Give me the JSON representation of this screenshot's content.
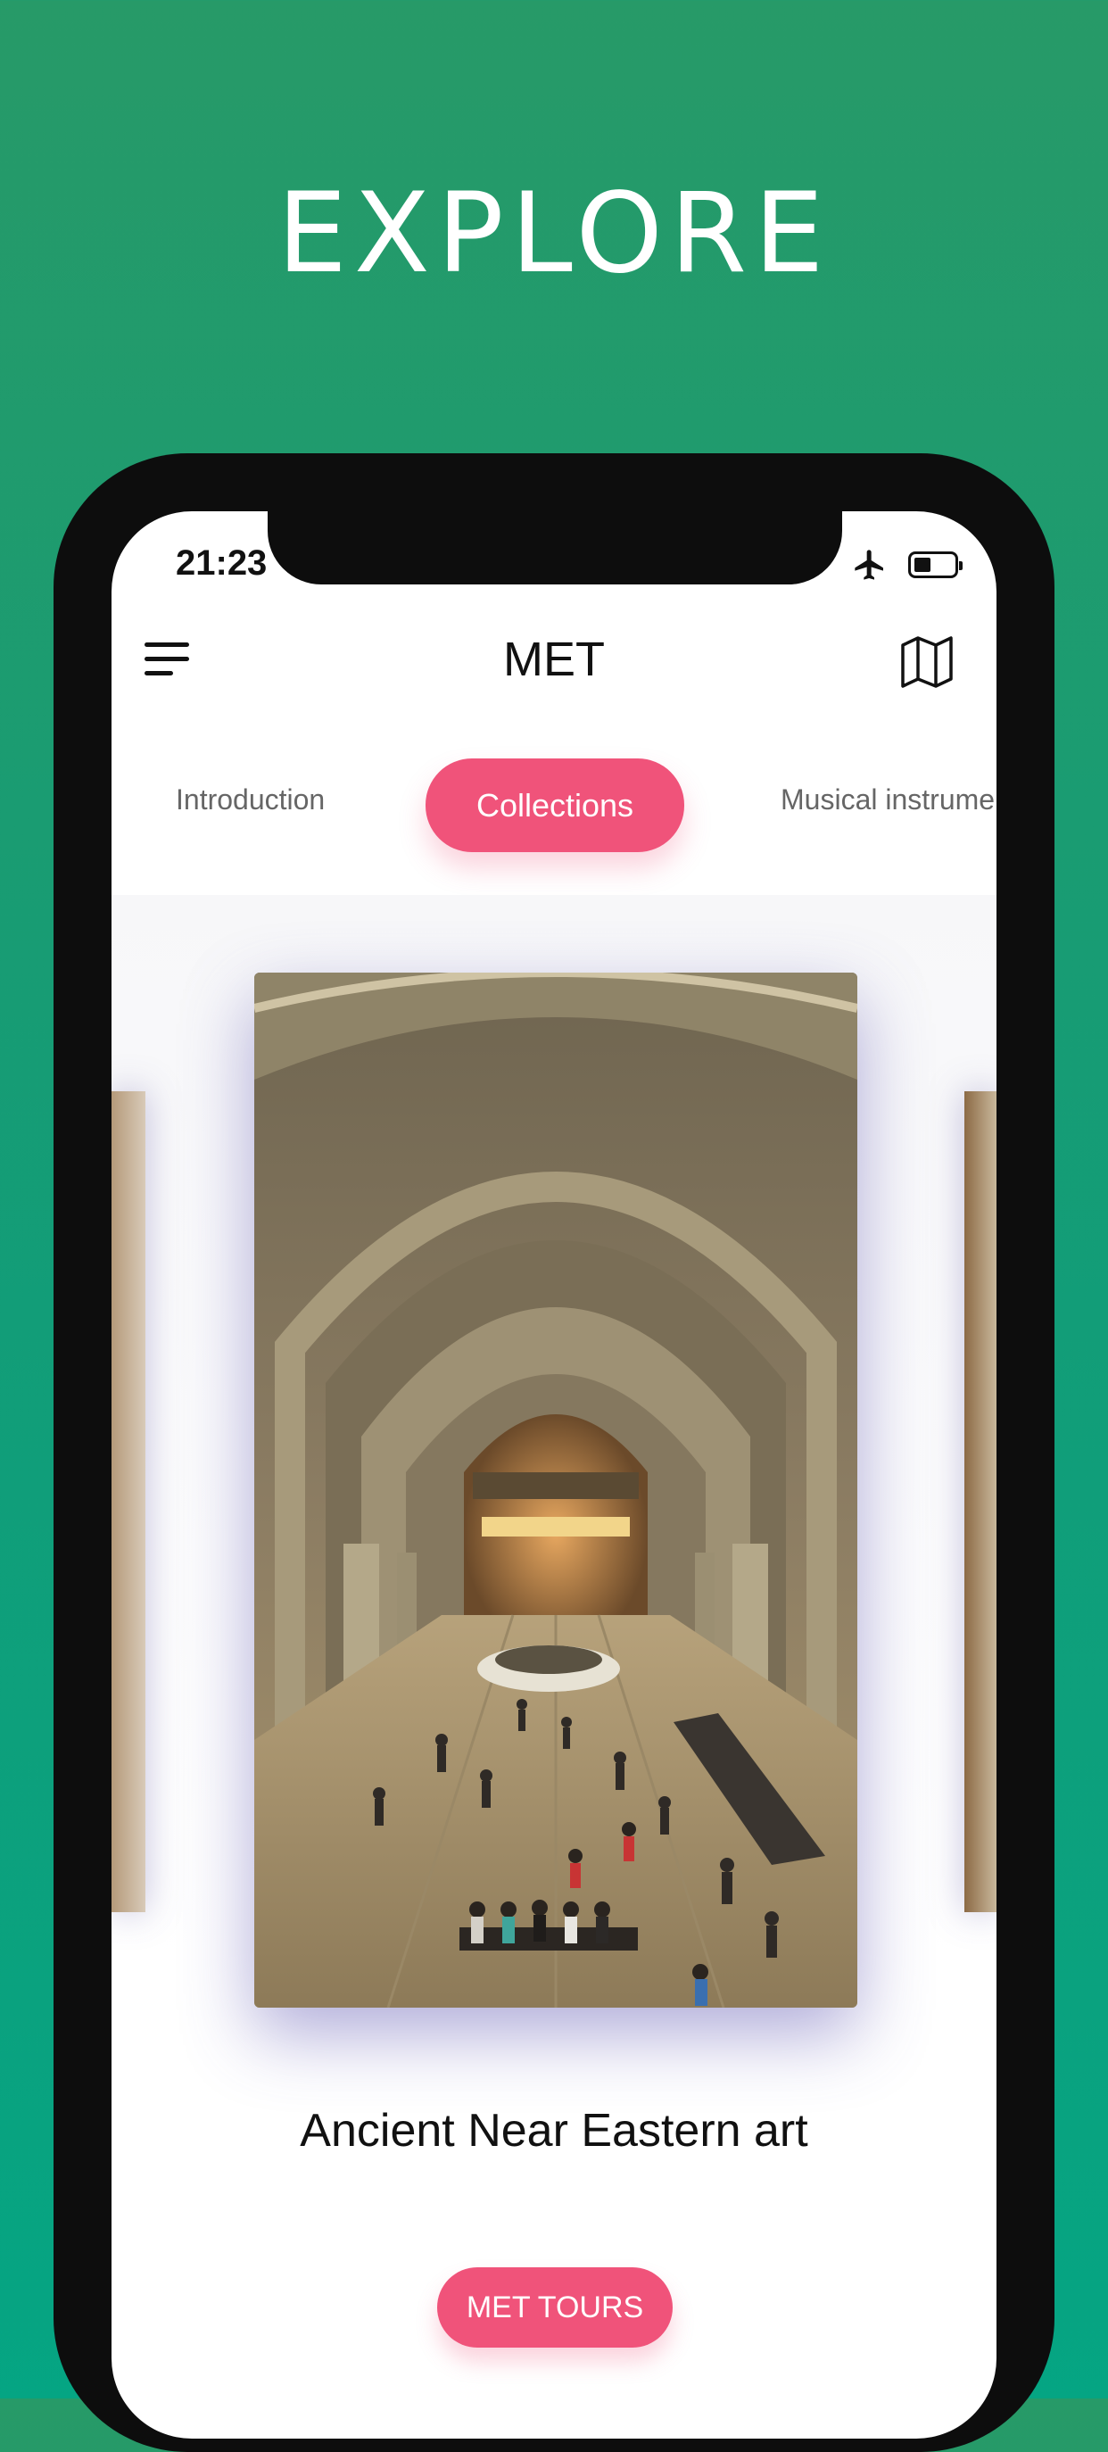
{
  "headline": "EXPLORE",
  "status_bar": {
    "time": "21:23",
    "icons": [
      "airplane-icon",
      "battery-icon"
    ]
  },
  "header": {
    "title": "MET",
    "left_icon": "menu-icon",
    "right_icon": "map-icon"
  },
  "tabs": [
    {
      "label": "Introduction",
      "active": false
    },
    {
      "label": "Collections",
      "active": true
    },
    {
      "label": "Musical instrume",
      "active": false
    }
  ],
  "carousel": {
    "current_caption": "Ancient Near Eastern art",
    "image_subject": "Great Hall museum interior"
  },
  "cta": {
    "label": "MET TOURS"
  },
  "colors": {
    "background_top": "#279a68",
    "background_bottom": "#05a583",
    "accent": "#f0537a",
    "phone_frame": "#0d0d0d"
  }
}
